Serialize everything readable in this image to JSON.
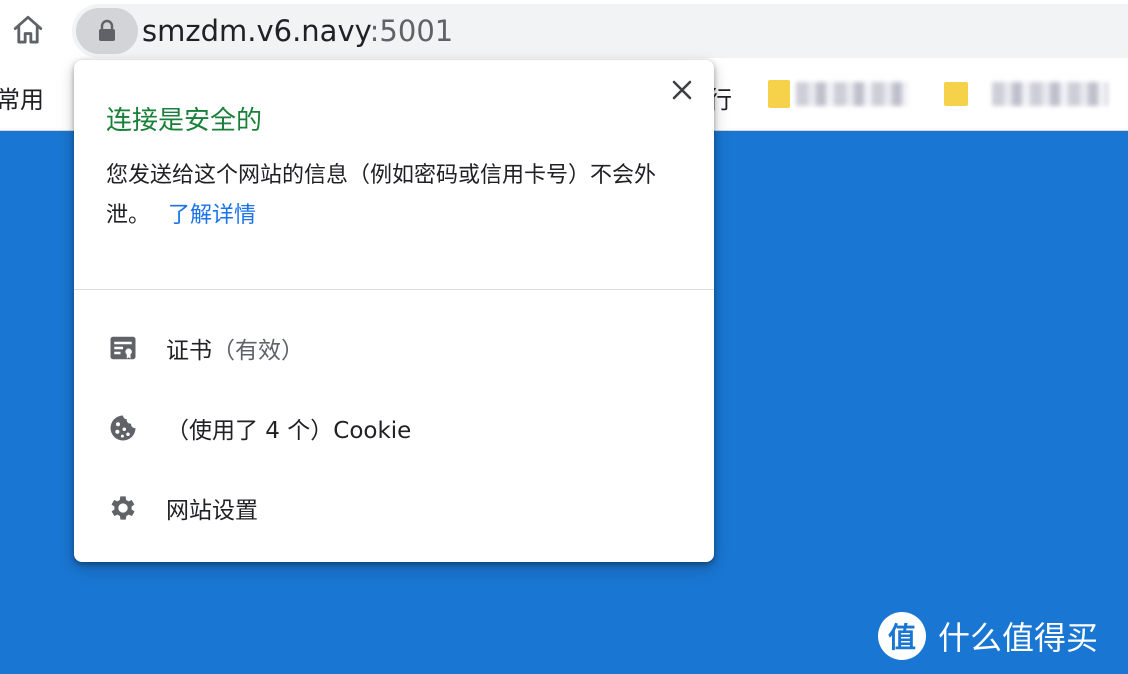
{
  "colors": {
    "page_bg": "#1976d2",
    "secure_green": "#188038",
    "link_blue": "#1a73e8",
    "text_dark": "#202124",
    "text_muted": "#5f6368"
  },
  "address_bar": {
    "url_host": "smzdm.v6.navy",
    "url_port": ":5001",
    "lock_icon": "lock-icon",
    "home_icon": "home-icon"
  },
  "bookmarks": {
    "left_label": "常用",
    "partial_label": "行"
  },
  "site_info_popup": {
    "title": "连接是安全的",
    "description": "您发送给这个网站的信息（例如密码或信用卡号）不会外泄。",
    "learn_more": "了解详情",
    "items": [
      {
        "icon": "certificate-icon",
        "label": "证书",
        "status": "（有效）"
      },
      {
        "icon": "cookie-icon",
        "label": "（使用了 4 个）Cookie"
      },
      {
        "icon": "gear-icon",
        "label": "网站设置"
      }
    ]
  },
  "watermark": {
    "logo_char": "值",
    "text": "什么值得买"
  }
}
